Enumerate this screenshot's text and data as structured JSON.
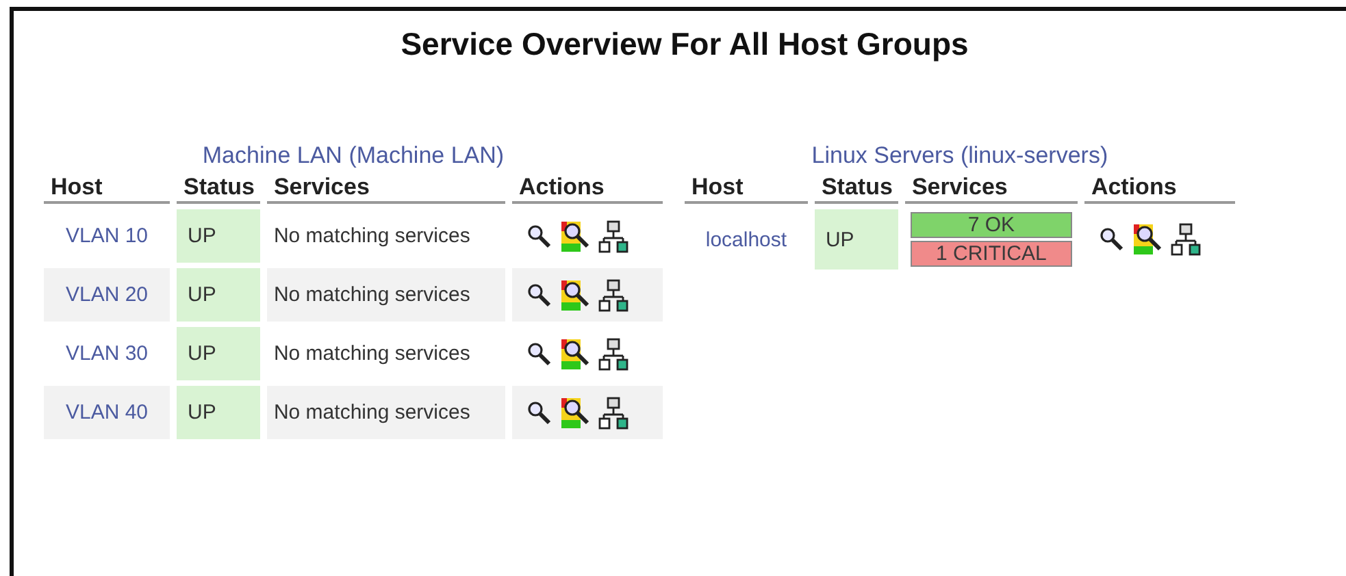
{
  "title": "Service Overview For All Host Groups",
  "groups": [
    {
      "name": "Machine LAN",
      "alias": "(Machine LAN)",
      "columns": [
        "Host",
        "Status",
        "Services",
        "Actions"
      ],
      "rows": [
        {
          "host": "VLAN 10",
          "status": "UP",
          "color": "#d9f3d3",
          "services": {
            "kind": "text",
            "text": "No matching services"
          }
        },
        {
          "host": "VLAN 20",
          "status": "UP",
          "color": "#d9f3d3",
          "services": {
            "kind": "text",
            "text": "No matching services"
          }
        },
        {
          "host": "VLAN 30",
          "status": "UP",
          "color": "#d9f3d3",
          "services": {
            "kind": "text",
            "text": "No matching services"
          }
        },
        {
          "host": "VLAN 40",
          "status": "UP",
          "color": "#d9f3d3",
          "services": {
            "kind": "text",
            "text": "No matching services"
          }
        }
      ]
    },
    {
      "name": "Linux Servers",
      "alias": "(linux-servers)",
      "columns": [
        "Host",
        "Status",
        "Services",
        "Actions"
      ],
      "rows": [
        {
          "host": "localhost",
          "status": "UP",
          "color": "#d9f3d3",
          "services": {
            "kind": "summary",
            "items": [
              {
                "label": "7 OK",
                "color": "#7fd36a"
              },
              {
                "label": "1 CRITICAL",
                "color": "#f08a8a"
              }
            ]
          }
        }
      ]
    }
  ]
}
